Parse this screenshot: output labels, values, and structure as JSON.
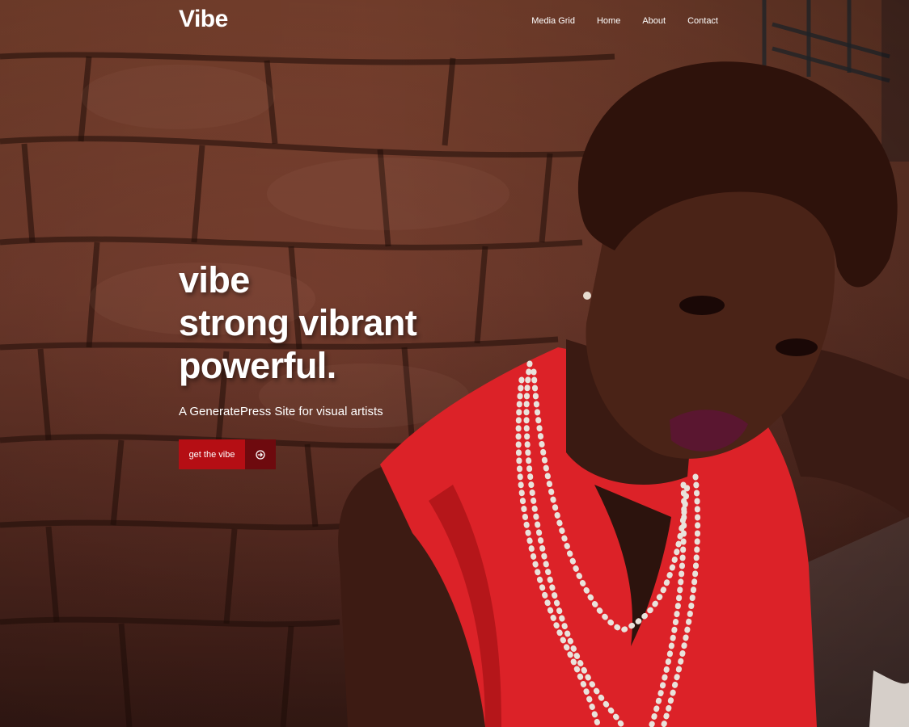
{
  "site": {
    "title": "Vibe"
  },
  "nav": {
    "items": [
      "Media Grid",
      "Home",
      "About",
      "Contact"
    ]
  },
  "hero": {
    "headline": [
      "vibe",
      "strong vibrant",
      "powerful."
    ],
    "subtitle": "A GeneratePress Site for visual artists",
    "button": {
      "label": "get the vibe",
      "icon": "arrow-right-circle-icon"
    }
  },
  "colors": {
    "button_primary": "#b50e14",
    "button_icon_bg": "#6e0a0e",
    "brick": "#8a4a34",
    "shirt": "#e0222a",
    "text": "#ffffff"
  }
}
